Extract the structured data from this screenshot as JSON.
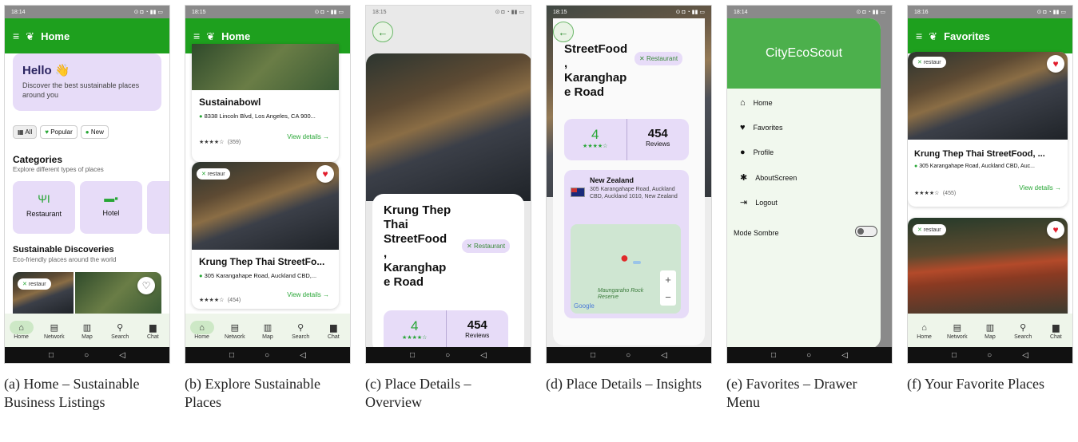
{
  "screens": {
    "a": {
      "time": "18:14",
      "status_icons": "⊙ ◘ ◔ ▮▮ ▭",
      "app_title": "Home",
      "hello": {
        "title": "Hello 👋",
        "text": "Discover the best sustainable places around you"
      },
      "filters": [
        "All",
        "Popular",
        "New"
      ],
      "categories": {
        "title": "Categories",
        "subtitle": "Explore different types of places",
        "items": [
          "Restaurant",
          "Hotel"
        ]
      },
      "discoveries": {
        "title": "Sustainable Discoveries",
        "subtitle": "Eco-friendly places around the world"
      },
      "tag": "restaur"
    },
    "b": {
      "time": "18:15",
      "status_icons": "⊙ ◘ ◔ ▮▮ ▭",
      "app_title": "Home",
      "card1": {
        "name": "Sustainabowl",
        "address": "8338 Lincoln Blvd, Los Angeles, CA 900...",
        "stars": "★★★★☆",
        "count": "(359)",
        "link": "View details →"
      },
      "card2": {
        "tag": "restaur",
        "name": "Krung Thep Thai StreetFo...",
        "address": "305 Karangahape Road, Auckland CBD,...",
        "stars": "★★★★☆",
        "count": "(454)",
        "link": "View details →"
      }
    },
    "c": {
      "time": "18:15",
      "status_icons": "⊙ ◘ ◔ ▮▮ ▭",
      "title_lines": [
        "Krung Thep",
        "Thai",
        "StreetFood",
        ",",
        "Karanghap",
        "e Road"
      ],
      "category": "Restaurant",
      "rating": "4",
      "stars": "★★★★☆",
      "reviews": "454",
      "reviews_label": "Reviews"
    },
    "d": {
      "time": "18:15",
      "status_icons": "⊙ ◘ ◔ ▮▮ ▭",
      "title_lines": [
        "StreetFood",
        ",",
        "Karanghap",
        "e Road"
      ],
      "category": "Restaurant",
      "rating": "4",
      "stars": "★★★★☆",
      "reviews": "454",
      "reviews_label": "Reviews",
      "country": "New Zealand",
      "address": "305 Karangahape Road, Auckland CBD, Auckland 1010, New Zealand",
      "map_place": "Maungarahо Rock Reserve",
      "map_brand": "Google",
      "zoom_in": "+",
      "zoom_out": "−"
    },
    "e": {
      "time": "18:14",
      "status_icons": "⊙ ◘ ◔ ▮▮ ▭",
      "app_name": "CityEcoScout",
      "menu": [
        {
          "label": "Home",
          "icon": "home-icon"
        },
        {
          "label": "Favorites",
          "icon": "heart-icon"
        },
        {
          "label": "Profile",
          "icon": "person-icon"
        },
        {
          "label": "AboutScreen",
          "icon": "gear-icon"
        },
        {
          "label": "Logout",
          "icon": "logout-icon"
        }
      ],
      "dark_mode": "Mode Sombre"
    },
    "f": {
      "time": "18:16",
      "status_icons": "⊙ ◘ ◔ ▮▮ ▭",
      "app_title": "Favorites",
      "card1": {
        "tag": "restaur",
        "name": "Krung Thep Thai StreetFood, ...",
        "address": "305 Karangahape Road, Auckland CBD, Auc...",
        "stars": "★★★★☆",
        "count": "(455)",
        "link": "View details →"
      },
      "card2": {
        "tag": "restaur"
      }
    }
  },
  "nav": [
    "Home",
    "Network",
    "Map",
    "Search",
    "Chat"
  ],
  "captions": {
    "a": "(a) Home – Sustainable Business Listings",
    "b": "(b) Explore Sustainable Places",
    "c": "(c) Place Details – Overview",
    "d": "(d) Place Details – Insights",
    "e": "(e) Favorites – Drawer Menu",
    "f": "(f) Your Favorite Places"
  },
  "colors": {
    "brand_green": "#1ea01e",
    "accent_lavender": "#e7dcf8",
    "heart_red": "#e21b2b"
  }
}
